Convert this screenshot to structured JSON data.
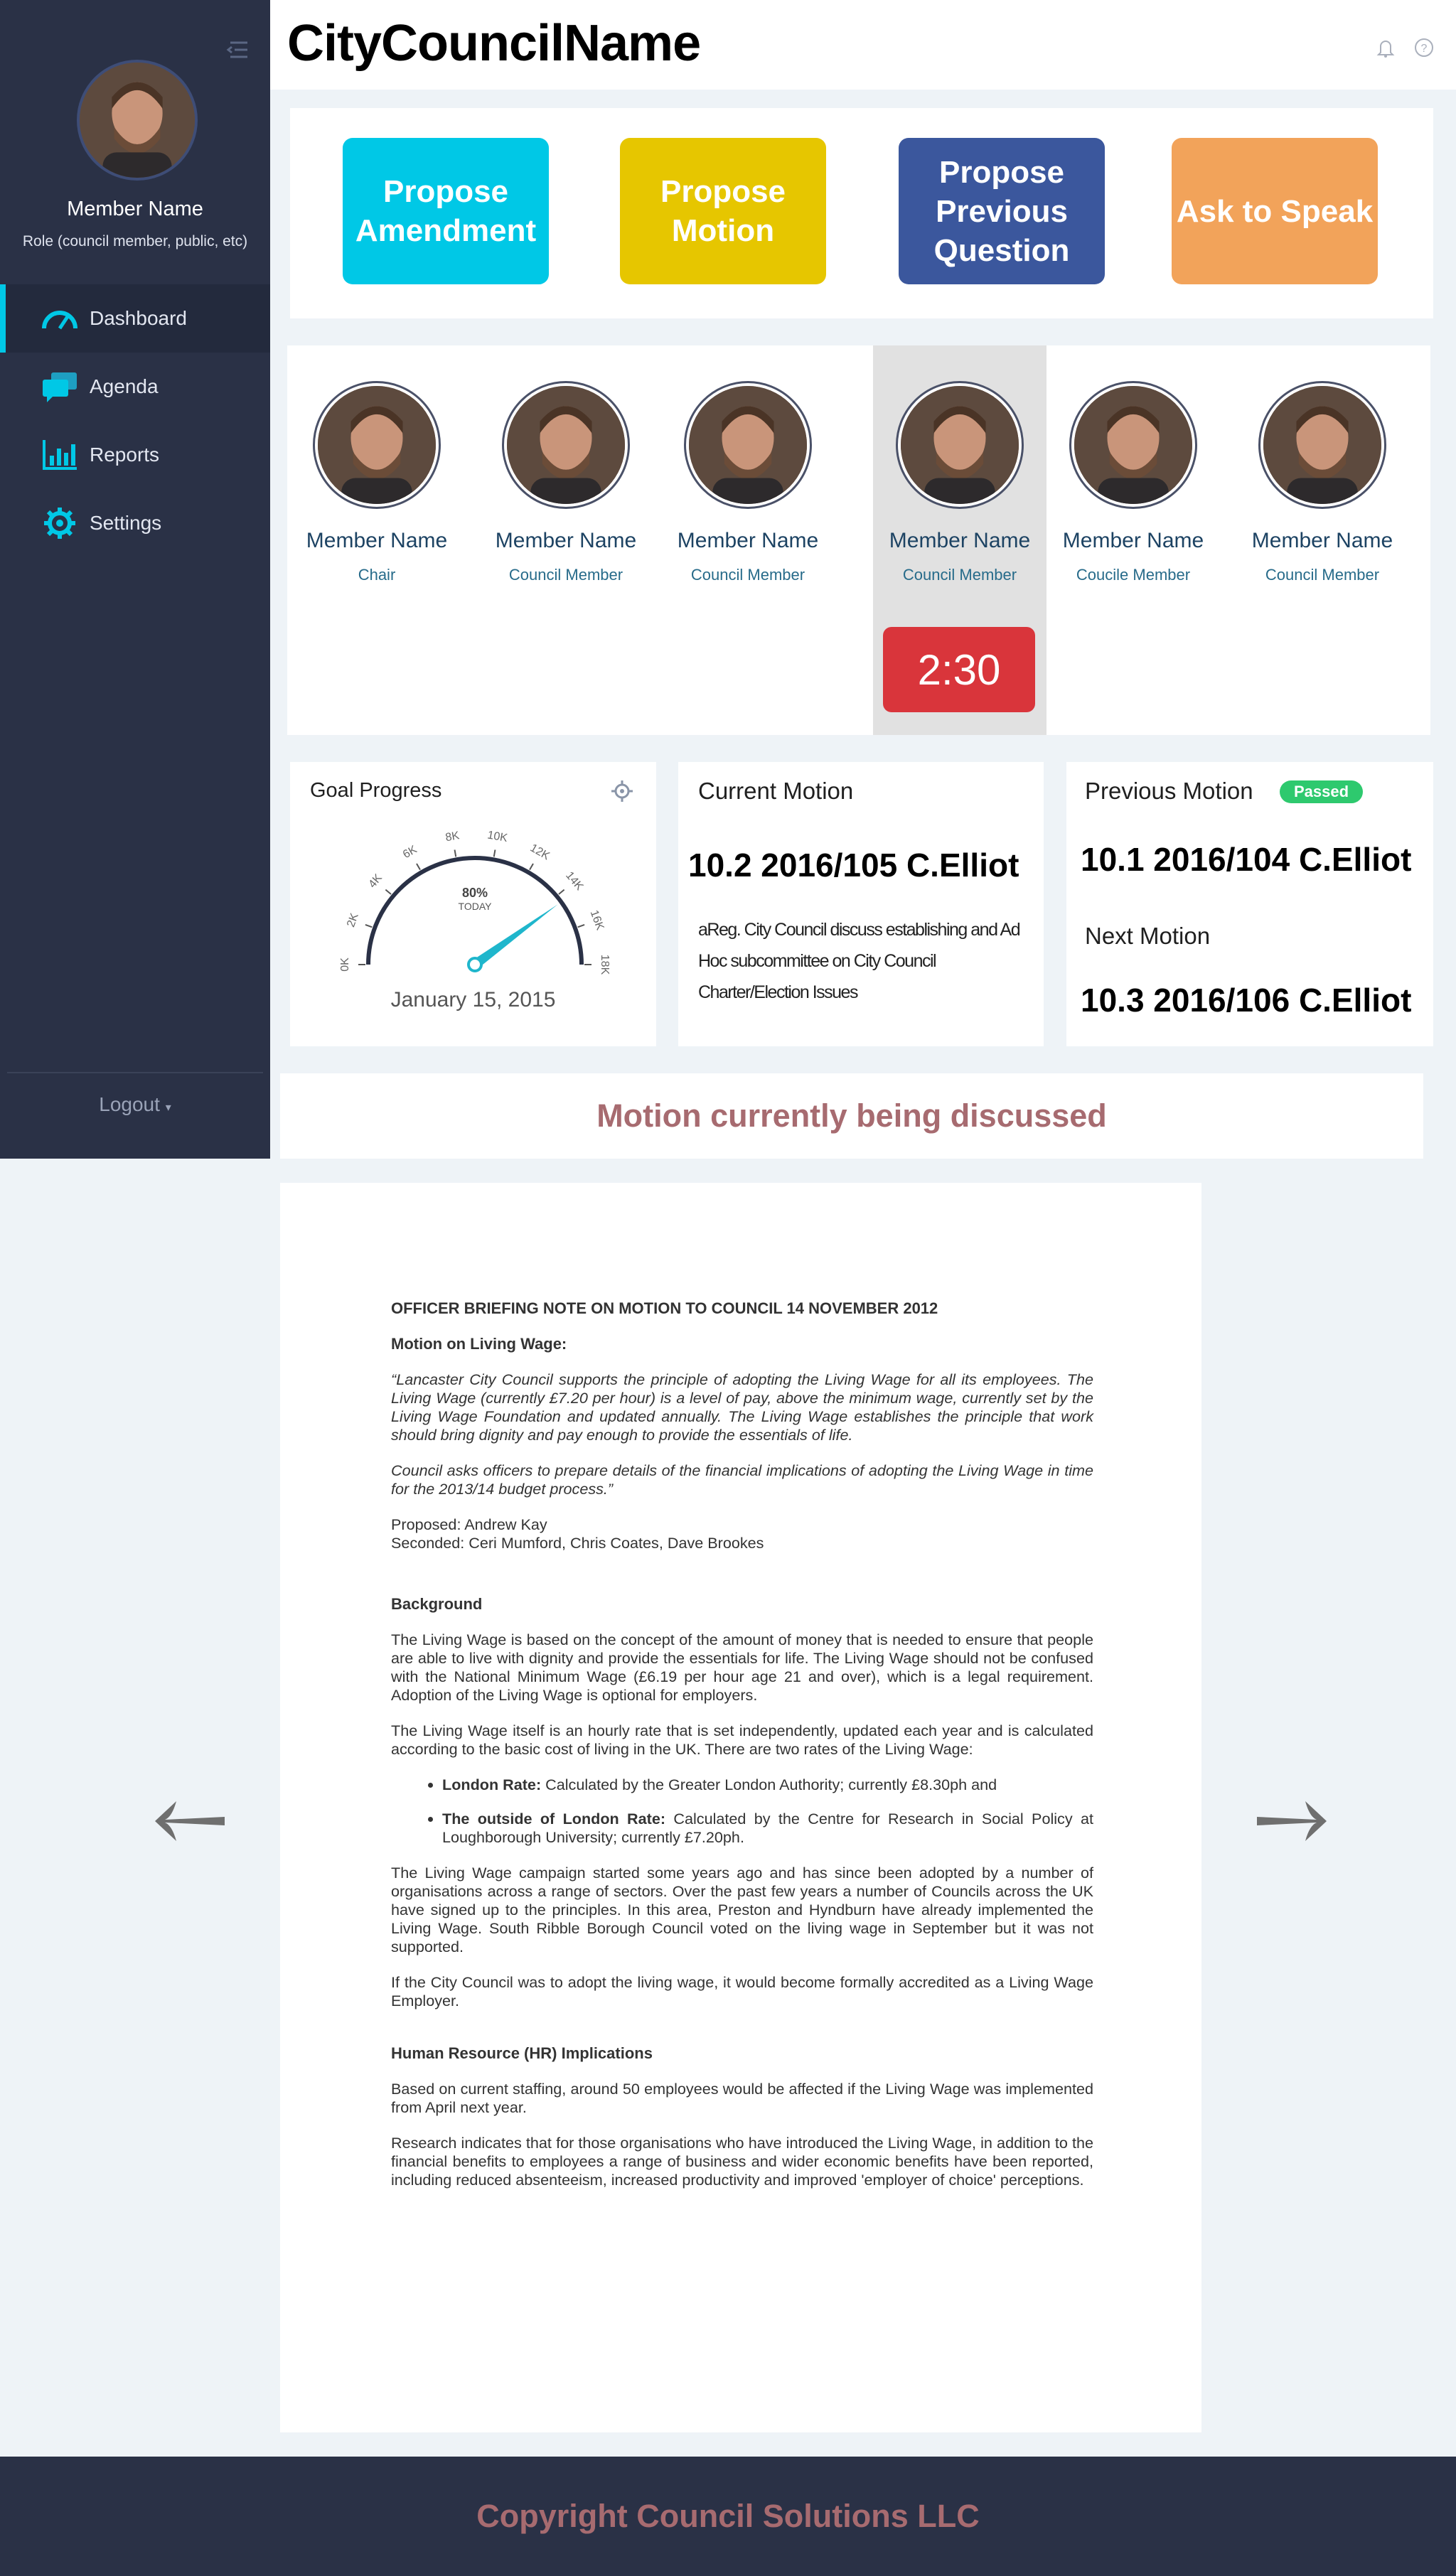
{
  "app": {
    "title": "CityCouncilName"
  },
  "user": {
    "name": "Member Name",
    "role": "Role (council member, public, etc)"
  },
  "nav": {
    "items": [
      {
        "label": "Dashboard",
        "icon": "gauge-icon",
        "active": true
      },
      {
        "label": "Agenda",
        "icon": "chat-icon"
      },
      {
        "label": "Reports",
        "icon": "bar-chart-icon"
      },
      {
        "label": "Settings",
        "icon": "gear-icon"
      }
    ],
    "logout": "Logout"
  },
  "actions": [
    {
      "label": "Propose Amendment",
      "color": "#00c8e6"
    },
    {
      "label": "Propose Motion",
      "color": "#e6c600"
    },
    {
      "label": "Propose Previous Question",
      "color": "#3b579d"
    },
    {
      "label": "Ask to Speak",
      "color": "#f2a35a"
    }
  ],
  "members": [
    {
      "name": "Member Name",
      "role": "Chair"
    },
    {
      "name": "Member Name",
      "role": "Council Member"
    },
    {
      "name": "Member Name",
      "role": "Council Member"
    },
    {
      "name": "Member Name",
      "role": "Council Member",
      "speaking": true
    },
    {
      "name": "Member Name",
      "role": "Coucile Member"
    },
    {
      "name": "Member Name",
      "role": "Council Member"
    }
  ],
  "timer": "2:30",
  "goal": {
    "title": "Goal Progress",
    "ticks": [
      "0K",
      "2K",
      "4K",
      "6K",
      "8K",
      "10K",
      "12K",
      "14K",
      "16K",
      "18K"
    ],
    "center_value": "80%",
    "center_label": "TODAY",
    "progress": 0.8,
    "date": "January 15, 2015"
  },
  "current_motion": {
    "title": "Current Motion",
    "number": "10.2 2016/105 C.Elliot",
    "description": "aReg. City Council discuss establishing and Ad Hoc subcommittee on City Council Charter/Election Issues"
  },
  "previous_motion": {
    "title": "Previous Motion",
    "status": "Passed",
    "number": "10.1 2016/104 C.Elliot"
  },
  "next_motion": {
    "title": "Next Motion",
    "number": "10.3 2016/106 C.Elliot"
  },
  "banner": "Motion currently being discussed",
  "document": {
    "heading": "OFFICER BRIEFING NOTE ON MOTION TO COUNCIL 14 NOVEMBER 2012",
    "motion_heading": "Motion on Living Wage:",
    "quote1": "“Lancaster City Council supports the principle of adopting the Living Wage for all its employees. The Living Wage (currently £7.20 per hour) is a level of pay, above the minimum wage, currently set by the Living Wage Foundation and updated annually. The Living Wage establishes the principle that work should bring dignity and pay enough to provide the essentials of life.",
    "quote2": "Council asks officers to prepare details of the financial implications of adopting the Living Wage in time for the 2013/14 budget process.”",
    "proposed": "Proposed: Andrew Kay",
    "seconded": "Seconded: Ceri Mumford, Chris Coates, Dave Brookes",
    "background_heading": "Background",
    "bg1": "The Living Wage is based on the concept of the amount of money that is needed to ensure that people are able to live with dignity and provide the essentials for life. The Living Wage should not be confused with the National Minimum Wage (£6.19 per hour age 21 and over), which is a legal requirement. Adoption of the Living Wage is optional for employers.",
    "bg2": "The Living Wage itself is an hourly rate that is set independently, updated each year and is calculated according to the basic cost of living in the UK. There are two rates of the Living Wage:",
    "bullet1_bold": "London Rate:",
    "bullet1_text": " Calculated by the Greater London Authority; currently £8.30ph and",
    "bullet2_bold": "The outside of London Rate:",
    "bullet2_text": " Calculated by the Centre for Research in Social Policy at Loughborough University; currently £7.20ph.",
    "bg3": "The Living Wage campaign started some years ago and has since been adopted by a number of organisations across a range of sectors. Over the past few years a number of Councils across the UK have signed up to the principles. In this area, Preston and Hyndburn have already implemented the Living Wage. South Ribble Borough Council voted on the living wage in September but it was not supported.",
    "bg4": "If the City Council was to adopt the living wage, it would become formally accredited as a Living Wage Employer.",
    "hr_heading": "Human Resource (HR) Implications",
    "hr1": "Based on current staffing, around 50 employees would be affected if the Living Wage was implemented from April next year.",
    "hr2": "Research indicates that for those organisations who have introduced the Living Wage, in addition to the financial benefits to employees a range of business and wider economic benefits have been reported, including reduced absenteeism, increased productivity and improved 'employer of choice' perceptions."
  },
  "footer": "Copyright Council Solutions LLC"
}
